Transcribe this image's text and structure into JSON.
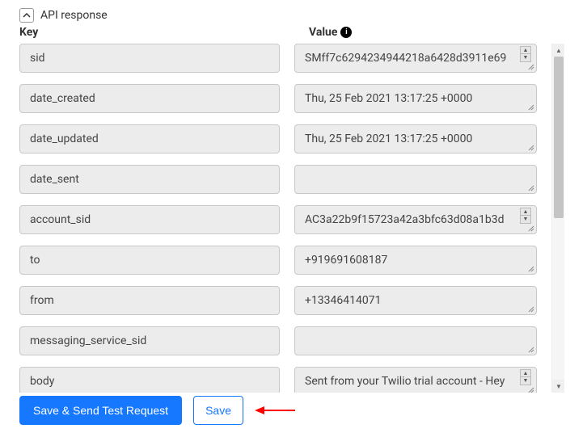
{
  "section_title": "API response",
  "columns": {
    "key_label": "Key",
    "value_label": "Value"
  },
  "rows": [
    {
      "key": "sid",
      "value": "SMff7c6294234944218a6428d3911e69",
      "scrollable": true
    },
    {
      "key": "date_created",
      "value": "Thu, 25 Feb 2021 13:17:25 +0000",
      "scrollable": false
    },
    {
      "key": "date_updated",
      "value": "Thu, 25 Feb 2021 13:17:25 +0000",
      "scrollable": false
    },
    {
      "key": "date_sent",
      "value": "",
      "scrollable": false
    },
    {
      "key": "account_sid",
      "value": "AC3a22b9f15723a42a3bfc63d08a1b3d",
      "scrollable": true
    },
    {
      "key": "to",
      "value": "+919691608187",
      "scrollable": false
    },
    {
      "key": "from",
      "value": "+13346414071",
      "scrollable": false
    },
    {
      "key": "messaging_service_sid",
      "value": "",
      "scrollable": false
    },
    {
      "key": "body",
      "value": "Sent from your Twilio trial account - Hey",
      "scrollable": true
    }
  ],
  "buttons": {
    "primary": "Save & Send Test Request",
    "secondary": "Save"
  },
  "colors": {
    "primary": "#1677ff",
    "arrow": "#ff0000"
  }
}
